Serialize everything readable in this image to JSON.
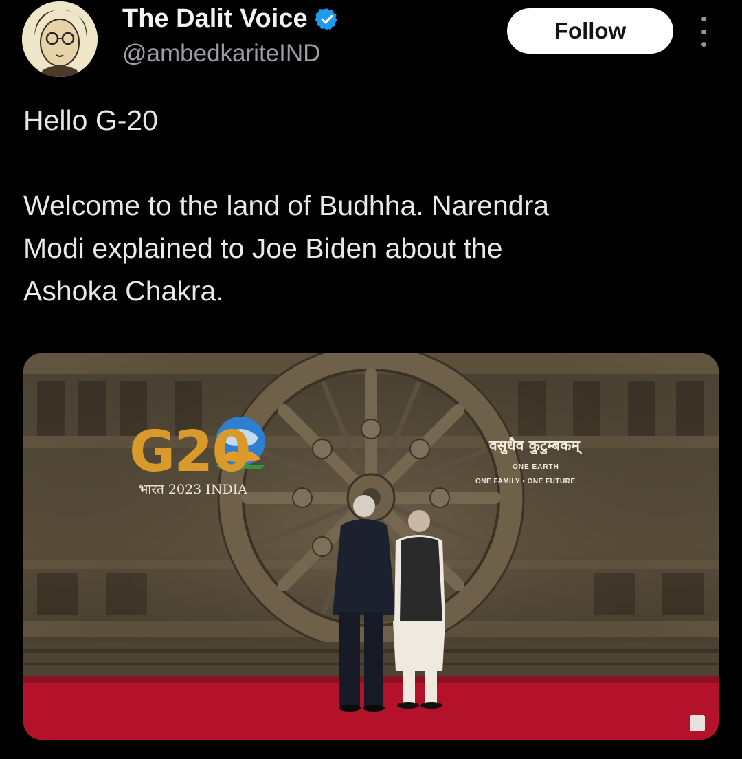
{
  "account": {
    "display_name": "The Dalit Voice",
    "handle": "@ambedkariteIND",
    "avatar_icon": "portrait-sketch-avatar",
    "verified_icon": "verified-badge-icon",
    "verified_color": "#1d9bf0"
  },
  "actions": {
    "follow_label": "Follow",
    "more_icon": "more-vertical-icon"
  },
  "tweet": {
    "text": "Hello G-20\n\nWelcome to the land of Budhha. Narendra\nModi explained to Joe Biden about the\nAshoka Chakra."
  },
  "media": {
    "logo_text": "G20",
    "logo_sub": "भारत 2023 INDIA",
    "motto_hindi": "वसुधैव कुटुम्बकम्",
    "motto_line1": "ONE EARTH",
    "motto_line2": "ONE FAMILY • ONE FUTURE",
    "carpet_color": "#b3122a"
  }
}
